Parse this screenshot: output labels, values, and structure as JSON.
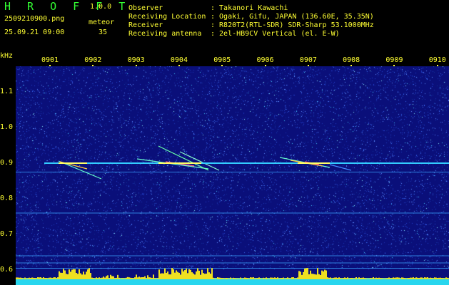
{
  "app": {
    "brand": "H R O F F T",
    "version": "1.0.0"
  },
  "file": {
    "filename": "2509210900.png",
    "datetime": "25.09.21 09:00",
    "count_label": "meteor",
    "count_value": "35"
  },
  "info": {
    "labels": [
      "Observer",
      "Receiving Location",
      "Receiver",
      "Receiving antenna"
    ],
    "values": [
      ": Takanori Kawachi",
      ": Ogaki, Gifu, JAPAN (136.60E, 35.35N)",
      ": R820T2(RTL-SDR) SDR-Sharp 53.1000MHz",
      ": 2el-HB9CV Vertical (el. E-W)"
    ]
  },
  "chart_data": {
    "type": "heatmap",
    "ylabel": "kHz",
    "y_ticks": [
      "1.1",
      "1.0",
      "0.9",
      "0.8",
      "0.7",
      "0.6"
    ],
    "x_ticks": [
      "0901",
      "0902",
      "0903",
      "0904",
      "0905",
      "0906",
      "0907",
      "0908",
      "0909",
      "0910"
    ],
    "ylim": [
      0.58,
      1.18
    ],
    "xlim": [
      "0900",
      "0910"
    ],
    "carrier_khz": 0.9,
    "background_color": "#0a0f7a"
  }
}
